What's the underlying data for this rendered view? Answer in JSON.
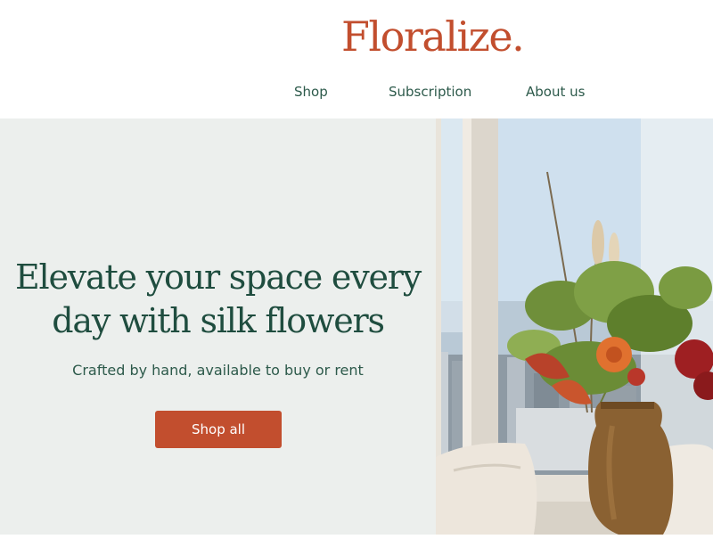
{
  "header": {
    "logo": "Floralize.",
    "nav": [
      "Shop",
      "Subscription",
      "About us"
    ]
  },
  "hero": {
    "headline_line1": "Elevate your space every",
    "headline_line2": "day with silk flowers",
    "subtitle": "Crafted by hand, available to buy or rent",
    "cta_label": "Shop all",
    "image_alt": "Silk flower arrangement in a ceramic vase by a high-rise window"
  },
  "colors": {
    "brand": "#c24e2e",
    "heading": "#1f4d3f",
    "nav_text": "#2d5a4b",
    "hero_bg": "#ecefed"
  }
}
